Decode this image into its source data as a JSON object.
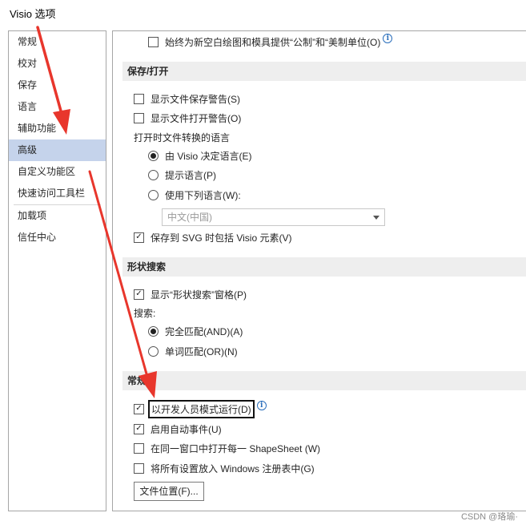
{
  "window": {
    "title": "Visio 选项"
  },
  "sidebar": {
    "items": [
      {
        "label": "常规"
      },
      {
        "label": "校对"
      },
      {
        "label": "保存"
      },
      {
        "label": "语言"
      },
      {
        "label": "辅助功能"
      },
      {
        "label": "高级",
        "selected": true
      },
      {
        "label": "自定义功能区"
      },
      {
        "label": "快速访问工具栏"
      },
      {
        "label": "加载项"
      },
      {
        "label": "信任中心"
      }
    ]
  },
  "main": {
    "top_option": {
      "label": "始终为新空白绘图和模具提供“公制”和“美制单位(O)",
      "checked": false
    },
    "save_open": {
      "header": "保存/打开",
      "show_save_warning": {
        "label": "显示文件保存警告(S)",
        "checked": false
      },
      "show_open_warning": {
        "label": "显示文件打开警告(O)",
        "checked": false
      },
      "conversion_language_label": "打开时文件转换的语言",
      "radio_visio": {
        "label": "由 Visio 决定语言(E)",
        "selected": true
      },
      "radio_prompt": {
        "label": "提示语言(P)",
        "selected": false
      },
      "radio_use": {
        "label": "使用下列语言(W):",
        "selected": false
      },
      "language_dropdown": {
        "value": "中文(中国)"
      },
      "include_svg": {
        "label": "保存到 SVG 时包括 Visio 元素(V)",
        "checked": true
      }
    },
    "shape_search": {
      "header": "形状搜索",
      "show_pane": {
        "label": "显示“形状搜索”窗格(P)",
        "checked": true
      },
      "search_label": "搜索:",
      "radio_all": {
        "label": "完全匹配(AND)(A)",
        "selected": true
      },
      "radio_any": {
        "label": "单词匹配(OR)(N)",
        "selected": false
      }
    },
    "general": {
      "header": "常规",
      "developer_mode": {
        "label": "以开发人员模式运行(D)",
        "checked": true
      },
      "auto_events": {
        "label": "启用自动事件(U)",
        "checked": true
      },
      "shapesheet": {
        "label": "在同一窗口中打开每一 ShapeSheet (W)",
        "checked": false
      },
      "registry": {
        "label": "将所有设置放入 Windows 注册表中(G)",
        "checked": false
      },
      "file_locations_button": "文件位置(F)..."
    }
  },
  "watermark": "CSDN @珞瑜·",
  "colors": {
    "selected_nav": "#c5d3eb",
    "section_header": "#eeeeee",
    "annotation_arrow": "#e8362c",
    "info_icon": "#2a6ebb"
  }
}
